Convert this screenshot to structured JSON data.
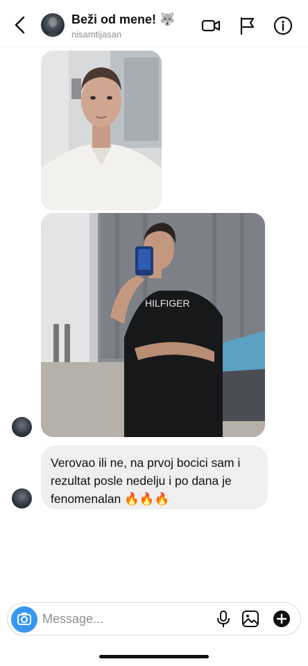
{
  "header": {
    "back_icon": "chevron-left-icon",
    "title": "Beži od mene! 🐺",
    "username": "nisamtijasan",
    "icons": [
      "video-call-icon",
      "flag-icon",
      "info-icon"
    ]
  },
  "messages": [
    {
      "type": "image",
      "description_icon": "photo"
    },
    {
      "type": "image",
      "description_icon": "photo"
    },
    {
      "type": "text",
      "text": "Verovao ili ne, na prvoj bocici sam i rezultat posle nedelju i po dana je fenomenalan 🔥🔥🔥"
    }
  ],
  "composer": {
    "placeholder": "Message...",
    "icons": [
      "camera-icon",
      "microphone-icon",
      "gallery-icon",
      "plus-icon"
    ],
    "accent_color": "#3897f0"
  }
}
